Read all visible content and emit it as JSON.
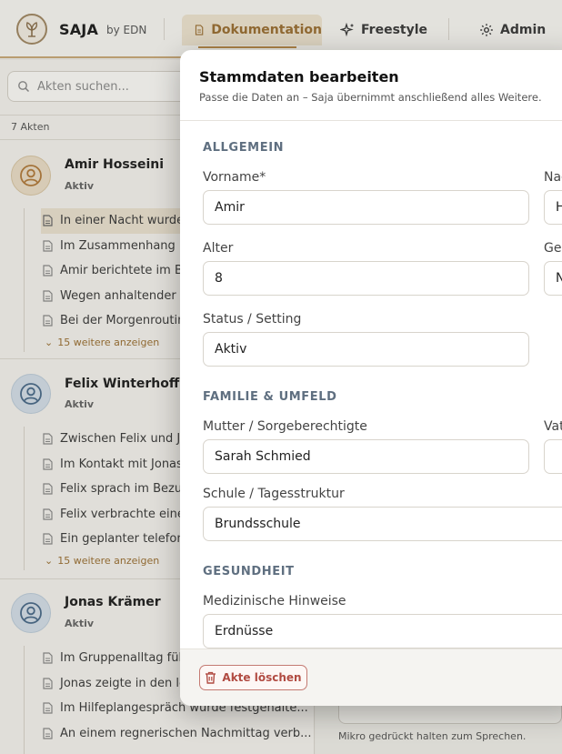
{
  "header": {
    "brand": "SAJA",
    "brand_sub": "by EDN",
    "tabs": [
      {
        "label": "Dokumentation",
        "active": true
      },
      {
        "label": "Freestyle"
      },
      {
        "label": "Admin"
      }
    ]
  },
  "sidebar": {
    "search_placeholder": "Akten suchen...",
    "count_label": "7 Akten",
    "akten": [
      {
        "name": "Amir Hosseini",
        "status": "Aktiv",
        "entries": [
          "In einer Nacht wurde",
          "Im Zusammenhang m",
          "Amir berichtete im Be",
          "Wegen anhaltender E",
          "Bei der Morgenroutin"
        ],
        "more": "15 weitere anzeigen"
      },
      {
        "name": "Felix Winterhoff",
        "status": "Aktiv",
        "entries": [
          "Zwischen Felix und Jo",
          "Im Kontakt mit Jonas",
          "Felix sprach im Bezug",
          "Felix verbrachte einer",
          "Ein geplanter telefoni"
        ],
        "more": "15 weitere anzeigen"
      },
      {
        "name": "Jonas Krämer",
        "status": "Aktiv",
        "entries": [
          "Im Gruppenalltag füh",
          "Jonas zeigte in den le",
          "Im Hilfeplangespräch wurde festgehalte...",
          "An einem regnerischen Nachmittag verb..."
        ]
      }
    ]
  },
  "main": {
    "mic_hint": "Mikro gedrückt halten zum Sprechen."
  },
  "modal": {
    "title": "Stammdaten bearbeiten",
    "subtitle": "Passe die Daten an – Saja übernimmt anschließend alles Weitere.",
    "sections": {
      "allgemein": "ALLGEMEIN",
      "familie": "FAMILIE & UMFELD",
      "gesundheit": "GESUNDHEIT"
    },
    "fields": {
      "vorname": {
        "label": "Vorname*",
        "value": "Amir"
      },
      "nachname": {
        "label": "Nac",
        "value": "H"
      },
      "alter": {
        "label": "Alter",
        "value": "8"
      },
      "geschlecht": {
        "label": "Ges",
        "value": "N"
      },
      "status": {
        "label": "Status / Setting",
        "value": "Aktiv"
      },
      "mutter": {
        "label": "Mutter / Sorgeberechtigte",
        "value": "Sarah Schmied"
      },
      "vater": {
        "label": "Vat",
        "value": ""
      },
      "schule": {
        "label": "Schule / Tagesstruktur",
        "value": "Brundsschule"
      },
      "medizin": {
        "label": "Medizinische Hinweise",
        "value": "Erdnüsse"
      }
    },
    "delete_label": "Akte löschen"
  },
  "colors": {
    "accent": "#9a6f33",
    "section_heading": "#5f6f80",
    "danger": "#b14b42"
  }
}
